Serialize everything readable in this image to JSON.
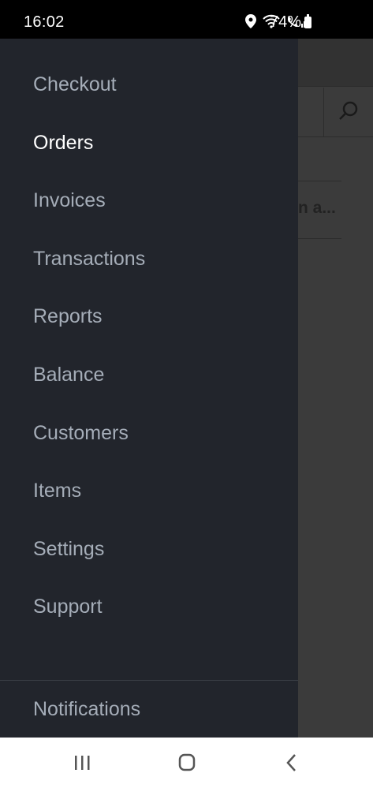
{
  "status_bar": {
    "time": "16:02",
    "battery_percent": "74%"
  },
  "drawer": {
    "items": [
      {
        "label": "Checkout"
      },
      {
        "label": "Orders",
        "active": true
      },
      {
        "label": "Invoices"
      },
      {
        "label": "Transactions"
      },
      {
        "label": "Reports"
      },
      {
        "label": "Balance"
      },
      {
        "label": "Customers"
      },
      {
        "label": "Items"
      },
      {
        "label": "Settings"
      },
      {
        "label": "Support"
      }
    ],
    "footer_item": "Notifications"
  },
  "background": {
    "row_text": "n a..."
  },
  "colors": {
    "drawer_bg": "#22252c",
    "menu_text": "#a5adb8",
    "menu_active": "#ffffff"
  }
}
